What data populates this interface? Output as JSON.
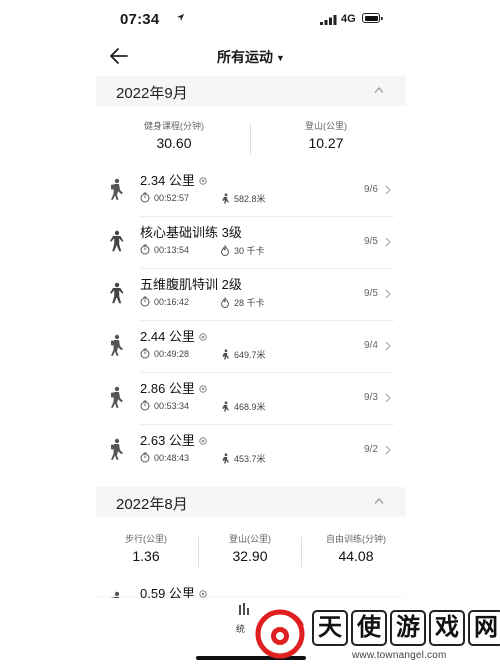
{
  "status_bar": {
    "time": "07:34",
    "network": "4G"
  },
  "nav": {
    "title": "所有运动",
    "caret": "▼"
  },
  "months": [
    {
      "label": "2022年9月",
      "stats": [
        {
          "label": "健身课程(分钟)",
          "value": "30.60"
        },
        {
          "label": "登山(公里)",
          "value": "10.27"
        }
      ],
      "items": [
        {
          "title": "2.34 公里",
          "type": "hiking",
          "duration": "00:52:57",
          "secondary": "582.8米",
          "secondary_icon": "climb-icon",
          "date": "9/6"
        },
        {
          "title": "核心基础训练 3级",
          "type": "training",
          "duration": "00:13:54",
          "secondary": "30 千卡",
          "secondary_icon": "flame-icon",
          "date": "9/5"
        },
        {
          "title": "五维腹肌特训 2级",
          "type": "training",
          "duration": "00:16:42",
          "secondary": "28 千卡",
          "secondary_icon": "flame-icon",
          "date": "9/5"
        },
        {
          "title": "2.44 公里",
          "type": "hiking",
          "duration": "00:49:28",
          "secondary": "649.7米",
          "secondary_icon": "climb-icon",
          "date": "9/4"
        },
        {
          "title": "2.86 公里",
          "type": "hiking",
          "duration": "00:53:34",
          "secondary": "468.9米",
          "secondary_icon": "climb-icon",
          "date": "9/3"
        },
        {
          "title": "2.63 公里",
          "type": "hiking",
          "duration": "00:48:43",
          "secondary": "453.7米",
          "secondary_icon": "climb-icon",
          "date": "9/2"
        }
      ]
    },
    {
      "label": "2022年8月",
      "stats": [
        {
          "label": "步行(公里)",
          "value": "1.36"
        },
        {
          "label": "登山(公里)",
          "value": "32.90"
        },
        {
          "label": "自由训练(分钟)",
          "value": "44.08"
        }
      ],
      "items": [
        {
          "title": "0.59 公里",
          "type": "hiking"
        }
      ]
    }
  ],
  "bottom_bar": {
    "tab_label": "统"
  },
  "watermark": {
    "chars": [
      "天",
      "使",
      "游",
      "戏",
      "网"
    ],
    "url": "www.townangel.com"
  },
  "colors": {
    "background": "#ffffff",
    "section": "#f6f6f6",
    "logo_red": "#e02020",
    "text": "#111111"
  }
}
